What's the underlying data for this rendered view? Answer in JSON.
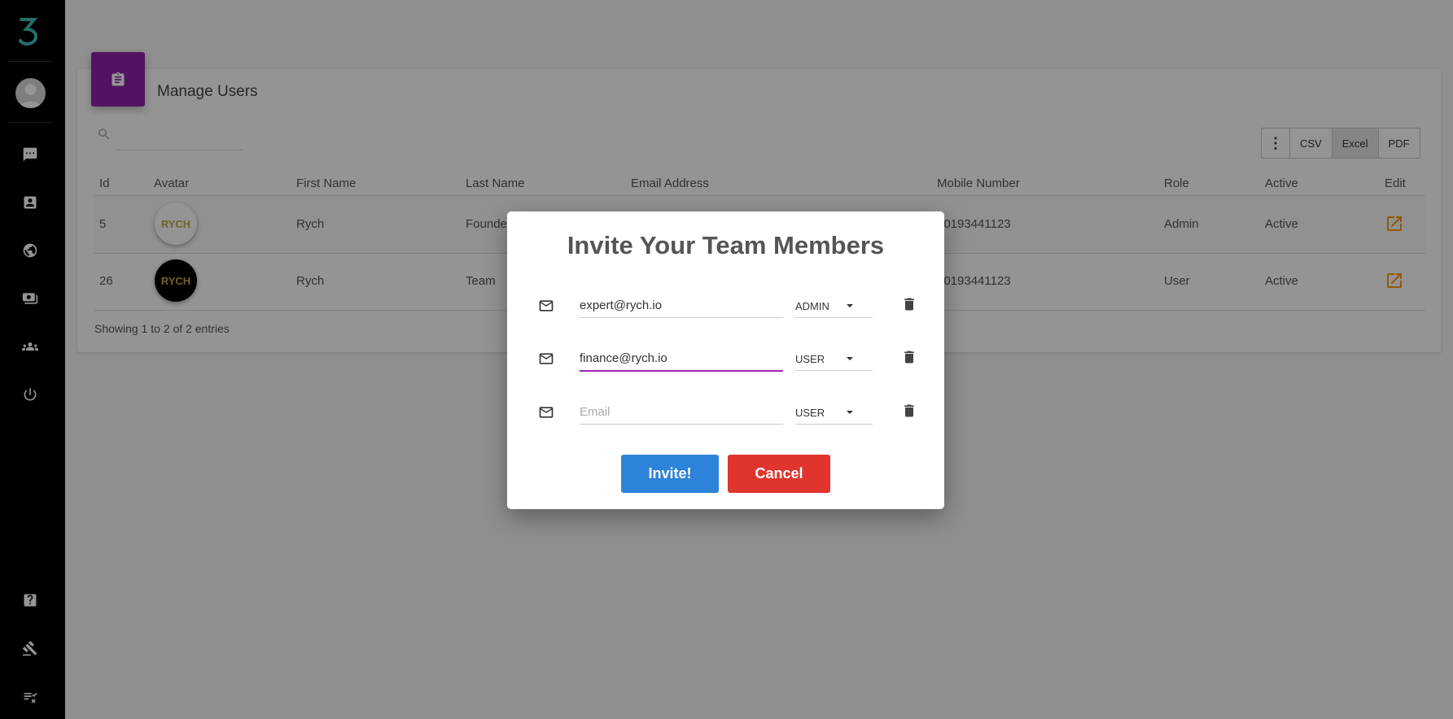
{
  "sidebar": {
    "logo": "brand-logo",
    "icons": [
      "chat-icon",
      "contact-card-icon",
      "globe-icon",
      "money-icon",
      "group-icon",
      "power-icon",
      "help-icon",
      "gavel-icon",
      "checklist-icon"
    ]
  },
  "page": {
    "title": "Manage Users",
    "export_buttons": [
      "CSV",
      "Excel",
      "PDF"
    ],
    "active_export": "Excel"
  },
  "table": {
    "columns": [
      "Id",
      "Avatar",
      "First Name",
      "Last Name",
      "Email Address",
      "Mobile Number",
      "Role",
      "Active",
      "Edit"
    ],
    "rows": [
      {
        "id": "5",
        "avatar_text": "RYCH",
        "first_name": "Rych",
        "last_name": "Founder",
        "mobile": "60193441123",
        "role": "Admin",
        "active": "Active"
      },
      {
        "id": "26",
        "avatar_text": "RYCH",
        "first_name": "Rych",
        "last_name": "Team",
        "mobile": "60193441123",
        "role": "User",
        "active": "Active"
      }
    ],
    "footer": "Showing 1 to 2 of 2 entries"
  },
  "modal": {
    "title": "Invite Your Team Members",
    "rows": [
      {
        "email": "expert@rych.io",
        "placeholder": "Email",
        "role": "ADMIN"
      },
      {
        "email": "finance@rych.io",
        "placeholder": "Email",
        "role": "USER"
      },
      {
        "email": "",
        "placeholder": "Email",
        "role": "USER"
      }
    ],
    "invite_label": "Invite!",
    "cancel_label": "Cancel"
  },
  "colors": {
    "accent_purple": "#8e24aa",
    "invite_blue": "#2c83d9",
    "cancel_red": "#e0342f",
    "edit_orange": "#ff9800",
    "logo_teal": "#3cc0b5"
  }
}
